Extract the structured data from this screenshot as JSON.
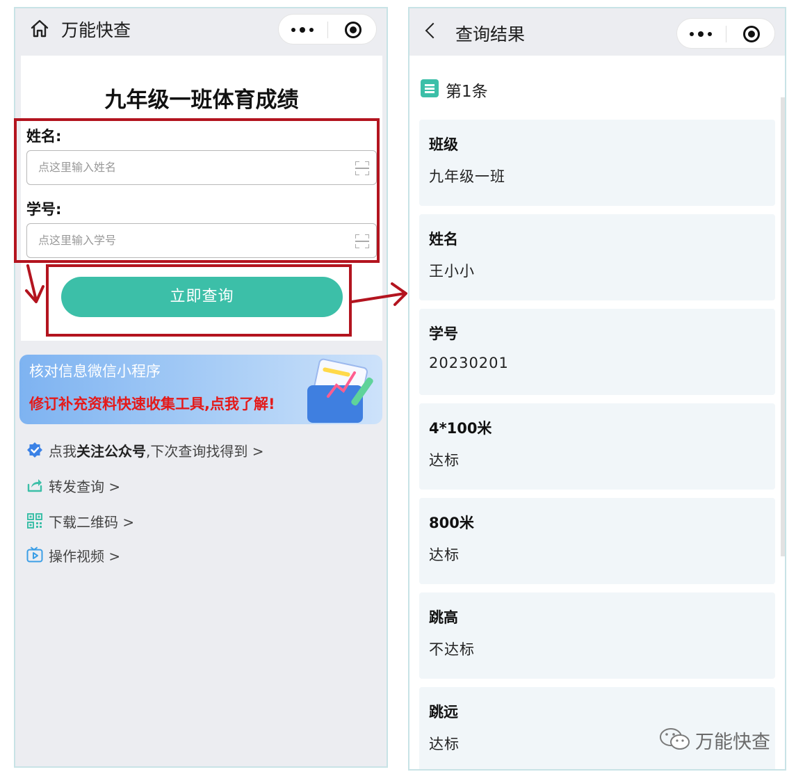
{
  "left_app": {
    "nav_title": "万能快查",
    "form_title": "九年级一班体育成绩",
    "name_label": "姓名:",
    "name_placeholder": "点这里输入姓名",
    "id_label": "学号:",
    "id_placeholder": "点这里输入学号",
    "query_button": "立即查询",
    "banner": {
      "title": "核对信息微信小程序",
      "subtitle": "修订补充资料快速收集工具,点我了解!"
    },
    "links": [
      {
        "prefix": "点我",
        "bold": "关注公众号",
        "suffix": ",下次查询找得到 >",
        "icon": "verified-badge-icon"
      },
      {
        "prefix": "转发查询 >",
        "bold": "",
        "suffix": "",
        "icon": "share-icon"
      },
      {
        "prefix": "下载二维码 >",
        "bold": "",
        "suffix": "",
        "icon": "qrcode-icon"
      },
      {
        "prefix": "操作视频 >",
        "bold": "",
        "suffix": "",
        "icon": "video-icon"
      }
    ]
  },
  "right_app": {
    "nav_title": "查询结果",
    "result_header": "第1条",
    "fields": [
      {
        "label": "班级",
        "value": "九年级一班"
      },
      {
        "label": "姓名",
        "value": "王小小"
      },
      {
        "label": "学号",
        "value": "20230201"
      },
      {
        "label": "4*100米",
        "value": "达标"
      },
      {
        "label": "800米",
        "value": "达标"
      },
      {
        "label": "跳高",
        "value": "不达标"
      },
      {
        "label": "跳远",
        "value": "达标"
      }
    ]
  },
  "watermark": "万能快查",
  "colors": {
    "accent": "#3cbfa8",
    "highlight": "#b3141f",
    "banner_red": "#e41a1a",
    "verified_blue": "#3b82e6"
  }
}
